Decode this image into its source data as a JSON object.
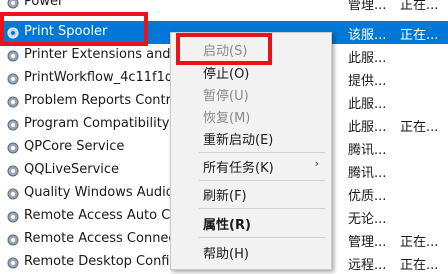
{
  "services": [
    {
      "name": "Power",
      "desc": "管理...",
      "status": "正在..."
    },
    {
      "name": "Print Spooler",
      "desc": "该服...",
      "status": "正在..."
    },
    {
      "name": "Printer Extensions and",
      "desc": "此服...",
      "status": ""
    },
    {
      "name": "PrintWorkflow_4c11f1d",
      "desc": "提供...",
      "status": ""
    },
    {
      "name": "Problem Reports Contro",
      "desc": "此服...",
      "status": ""
    },
    {
      "name": "Program Compatibility",
      "desc": "此服...",
      "status": "正在..."
    },
    {
      "name": "QPCore Service",
      "desc": "腾讯...",
      "status": ""
    },
    {
      "name": "QQLiveService",
      "desc": "腾讯...",
      "status": ""
    },
    {
      "name": "Quality Windows Audio",
      "desc": "优质...",
      "status": ""
    },
    {
      "name": "Remote Access Auto Co",
      "desc": "无论...",
      "status": ""
    },
    {
      "name": "Remote Access Connecti",
      "desc": "管理...",
      "status": "正在..."
    },
    {
      "name": "Remote Desktop Configuration",
      "desc": "远程...",
      "status": "正在..."
    }
  ],
  "context_menu": {
    "start": "启动(S)",
    "stop": "停止(O)",
    "pause": "暂停(U)",
    "resume": "恢复(M)",
    "restart": "重新启动(E)",
    "all_tasks": "所有任务(K)",
    "refresh": "刷新(F)",
    "properties": "属性(R)",
    "help": "帮助(H)"
  },
  "colors": {
    "selection": "#0078d7",
    "highlight_box": "#e8141c",
    "menu_bg": "#f2f2f2"
  }
}
